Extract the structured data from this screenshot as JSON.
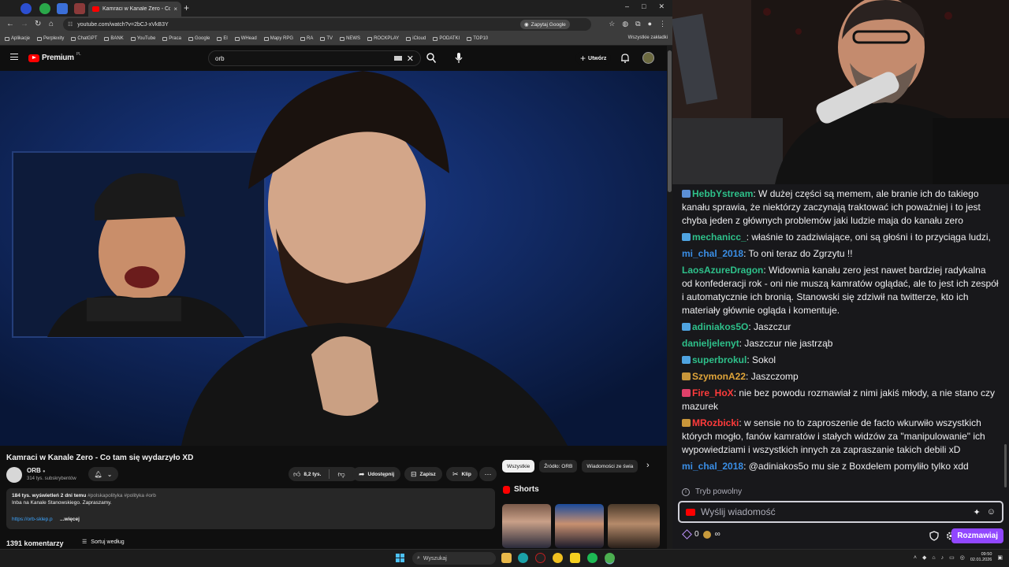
{
  "browser": {
    "tab_title": "Kamraci w Kanale Zero - Co tam",
    "url": "youtube.com/watch?v=2bCJ-xVkB3Y",
    "ask_google": "Zapytaj Google",
    "bookmarks": [
      "Aplikacje",
      "Perplexity",
      "ChatGPT",
      "BANK",
      "YouTube",
      "Praca",
      "Google",
      "El",
      "WHead",
      "Mapy RPG",
      "RA",
      "TV",
      "NEWS",
      "ROCKPLAY",
      "iCloud",
      "PODATKI",
      "TOP10"
    ],
    "bookmarks_right": "Wszystkie zakładki"
  },
  "youtube": {
    "logo": "Premium",
    "logo_suffix": "PL",
    "search_query": "orb",
    "create_label": "Utwórz",
    "video_title": "Kamraci w Kanale Zero - Co tam się wydarzyło XD",
    "channel_name": "ORB",
    "channel_subs": "314 tys. subskrybentów",
    "likes": "8,2 tys.",
    "share_label": "Udostępnij",
    "save_label": "Zapisz",
    "clip_label": "Klip",
    "desc_stats": "184 tys. wyświetleń  2 dni temu ",
    "desc_tags": "#polskapolityka #polityka #orb",
    "desc_line": "Inba na Kanale Stanowskiego. Zapraszamy.",
    "desc_link": "https://orb-sklep.p",
    "desc_more": "...więcej",
    "comments_count": "1391 komentarzy",
    "sort_label": "Sortuj według",
    "chips": [
      "Wszystkie",
      "Źródło: ORB",
      "Wiadomości ze świa"
    ],
    "shorts_label": "Shorts"
  },
  "chat": {
    "messages": [
      {
        "user": "HebbYstream",
        "color": "#2ec08a",
        "text": ": W dużej części są memem, ale branie ich do takiego kanału sprawia, że niektórzy zaczynają traktować ich poważniej i to jest chyba jeden z głównych problemów jaki ludzie maja do kanału zero",
        "badge": "#5b8fd6"
      },
      {
        "user": "mechanicc_",
        "color": "#2ec08a",
        "text": ": właśnie to zadziwiające, oni są głośni i to przyciąga ludzi,",
        "badge": "#4fa3e0"
      },
      {
        "user": "mi_chal_2018",
        "color": "#3a8ee6",
        "text": ": To oni teraz do Zgrzytu !!",
        "badge": ""
      },
      {
        "user": "LaosAzureDragon",
        "color": "#2ec08a",
        "text": ": Widownia kanału zero jest nawet bardziej radykalna od konfederacji rok - oni nie muszą kamratów oglądać, ale to jest ich zespół i automatycznie ich bronią. Stanowski się zdziwił na twitterze, kto ich materiały głównie ogląda i komentuje.",
        "badge": ""
      },
      {
        "user": "adiniakos5O",
        "color": "#2ec08a",
        "text": ": Jaszczur",
        "badge": "#4fa3e0"
      },
      {
        "user": "danieljelenyt",
        "color": "#2ec08a",
        "text": ": Jaszczur nie jastrząb",
        "badge": ""
      },
      {
        "user": "superbrokul",
        "color": "#2ec08a",
        "text": ": Sokol",
        "badge": "#4fa3e0"
      },
      {
        "user": "SzymonA22",
        "color": "#e0a53a",
        "text": ": Jaszczomp",
        "badge": "#c9963a"
      },
      {
        "user": "Fire_HoX",
        "color": "#ff3b3b",
        "text": ": nie bez powodu rozmawiał z nimi jakiś młody, a nie stano czy mazurek",
        "badge": "#e0406a"
      },
      {
        "user": "MRozbicki",
        "color": "#ff3b3b",
        "text": ": w sensie no to zaproszenie de facto wkurwiło wszystkich których mogło, fanów kamratów i stałych widzów za \"manipulowanie\" ich wypowiedziami i wszystkich innych za zapraszanie takich debili xD",
        "badge": "#c9963a"
      },
      {
        "user": "mi_chal_2018",
        "color": "#3a8ee6",
        "text": ": @adiniakos5o mu sie z Boxdelem pomyliło tylko xdd",
        "badge": ""
      }
    ],
    "slow_mode": "Tryb powolny",
    "input_placeholder": "Wyślij wiadomość",
    "points_value": "0",
    "send_label": "Rozmawiaj"
  },
  "taskbar": {
    "search_placeholder": "Wyszukaj",
    "time": "09:50",
    "date": "02.01.2026"
  },
  "colors": {
    "yt_red": "#ff0000",
    "twitch_purple": "#9147ff",
    "link_blue": "#3ea6ff"
  }
}
